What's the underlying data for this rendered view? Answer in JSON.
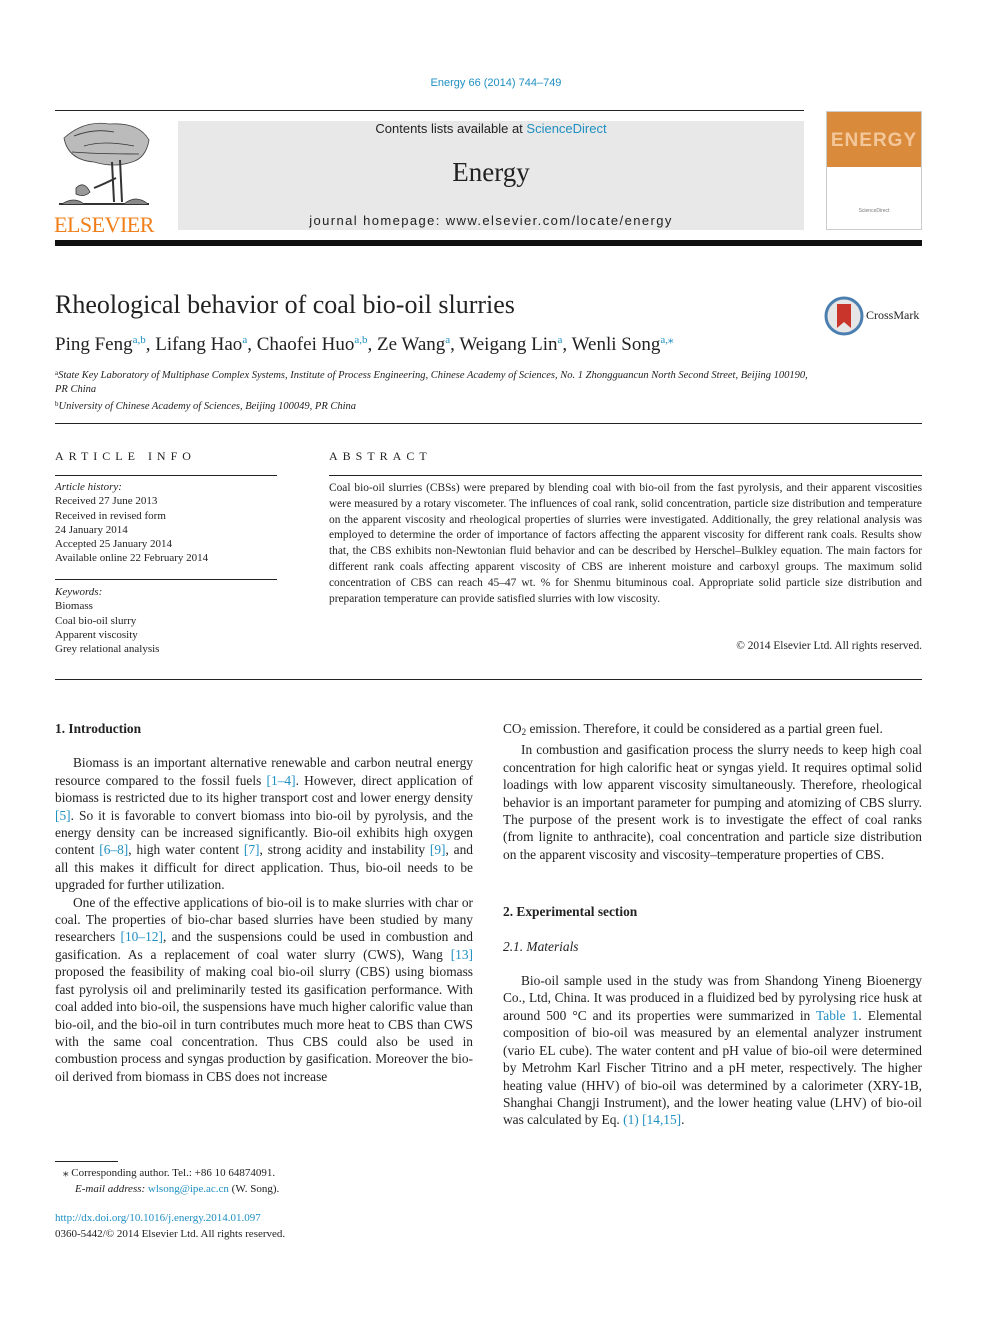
{
  "citation": "Energy 66 (2014) 744–749",
  "header": {
    "publisher_logo": "ELSEVIER",
    "contents_prefix": "Contents lists available at ",
    "contents_link": "ScienceDirect",
    "journal_name": "Energy",
    "homepage": "journal homepage: www.elsevier.com/locate/energy",
    "cover_title": "ENERGY",
    "cover_footer": "ScienceDirect",
    "colors": {
      "publisher_orange": "#f07f1a",
      "link_blue": "#1f8fc1",
      "band_grey": "#e8e8e8",
      "cover_orange": "#d98a3a"
    }
  },
  "article": {
    "title": "Rheological behavior of coal bio-oil slurries",
    "crossmark_label": "CrossMark",
    "authors": [
      {
        "name": "Ping Feng",
        "sup": "a,b"
      },
      {
        "name": "Lifang Hao",
        "sup": "a"
      },
      {
        "name": "Chaofei Huo",
        "sup": "a,b"
      },
      {
        "name": "Ze Wang",
        "sup": "a"
      },
      {
        "name": "Weigang Lin",
        "sup": "a"
      },
      {
        "name": "Wenli Song",
        "sup": "a,⁎"
      }
    ],
    "affiliations": [
      {
        "mark": "a",
        "text": "State Key Laboratory of Multiphase Complex Systems, Institute of Process Engineering, Chinese Academy of Sciences, No. 1 Zhongguancun North Second Street, Beijing 100190, PR China"
      },
      {
        "mark": "b",
        "text": "University of Chinese Academy of Sciences, Beijing 100049, PR China"
      }
    ]
  },
  "article_info": {
    "heading": "ARTICLE INFO",
    "history_label": "Article history:",
    "history": [
      "Received 27 June 2013",
      "Received in revised form",
      "24 January 2014",
      "Accepted 25 January 2014",
      "Available online 22 February 2014"
    ],
    "keywords_label": "Keywords:",
    "keywords": [
      "Biomass",
      "Coal bio-oil slurry",
      "Apparent viscosity",
      "Grey relational analysis"
    ]
  },
  "abstract": {
    "heading": "ABSTRACT",
    "text": "Coal bio-oil slurries (CBSs) were prepared by blending coal with bio-oil from the fast pyrolysis, and their apparent viscosities were measured by a rotary viscometer. The influences of coal rank, solid concentration, particle size distribution and temperature on the apparent viscosity and rheological properties of slurries were investigated. Additionally, the grey relational analysis was employed to determine the order of importance of factors affecting the apparent viscosity for different rank coals. Results show that, the CBS exhibits non-Newtonian fluid behavior and can be described by Herschel–Bulkley equation. The main factors for different rank coals affecting apparent viscosity of CBS are inherent moisture and carboxyl groups. The maximum solid concentration of CBS can reach 45–47 wt. % for Shenmu bituminous coal. Appropriate solid particle size distribution and preparation temperature can provide satisfied slurries with low viscosity.",
    "copyright": "© 2014 Elsevier Ltd. All rights reserved."
  },
  "body": {
    "intro_heading": "1.  Introduction",
    "intro_p1": [
      "Biomass is an important alternative renewable and carbon neutral energy resource compared to the fossil fuels ",
      "[1–4]",
      ". However, direct application of biomass is restricted due to its higher transport cost and lower energy density ",
      "[5]",
      ". So it is favorable to convert biomass into bio-oil by pyrolysis, and the energy density can be increased significantly. Bio-oil exhibits high oxygen content ",
      "[6–8]",
      ", high water content ",
      "[7]",
      ", strong acidity and instability ",
      "[9]",
      ", and all this makes it difficult for direct application. Thus, bio-oil needs to be upgraded for further utilization."
    ],
    "intro_p2": [
      "One of the effective applications of bio-oil is to make slurries with char or coal. The properties of bio-char based slurries have been studied by many researchers ",
      "[10–12]",
      ", and the suspensions could be used in combustion and gasification. As a replacement of coal water slurry (CWS), Wang ",
      "[13]",
      " proposed the feasibility of making coal bio-oil slurry (CBS) using biomass fast pyrolysis oil and preliminarily tested its gasification performance. With coal added into bio-oil, the suspensions have much higher calorific value than bio-oil, and the bio-oil in turn contributes much more heat to CBS than CWS with the same coal concentration. Thus CBS could also be used in combustion process and syngas production by gasification. Moreover the bio-oil derived from biomass in CBS does not increase"
    ],
    "right_p0_co": "CO",
    "right_p0_sub": "2",
    "right_p0_rest": " emission. Therefore, it could be considered as a partial green fuel.",
    "right_p1": "In combustion and gasification process the slurry needs to keep high coal concentration for high calorific heat or syngas yield. It requires optimal solid loadings with low apparent viscosity simultaneously. Therefore, rheological behavior is an important parameter for pumping and atomizing of CBS slurry. The purpose of the present work is to investigate the effect of coal ranks (from lignite to anthracite), coal concentration and particle size distribution on the apparent viscosity and viscosity–temperature properties of CBS.",
    "exp_heading": "2.  Experimental section",
    "materials_heading": "2.1.  Materials",
    "materials_p": [
      "Bio-oil sample used in the study was from Shandong Yineng Bioenergy Co., Ltd, China. It was produced in a fluidized bed by pyrolysing rice husk at around 500 °C and its properties were summarized in ",
      "Table 1",
      ". Elemental composition of bio-oil was measured by an elemental analyzer instrument (vario EL cube). The water content and pH value of bio-oil were determined by Metrohm Karl Fischer Titrino and a pH meter, respectively. The higher heating value (HHV) of bio-oil was determined by a calorimeter (XRY-1B, Shanghai Changji Instrument), and the lower heating value (LHV) of bio-oil was calculated by Eq. ",
      "(1)",
      " ",
      "[14,15]",
      "."
    ]
  },
  "footnotes": {
    "corresponding": "⁎  Corresponding author. Tel.: +86 10 64874091.",
    "email_label": "E-mail address: ",
    "email": "wlsong@ipe.ac.cn",
    "email_suffix": " (W. Song).",
    "doi": "http://dx.doi.org/10.1016/j.energy.2014.01.097",
    "issn": "0360-5442/© 2014 Elsevier Ltd. All rights reserved."
  }
}
